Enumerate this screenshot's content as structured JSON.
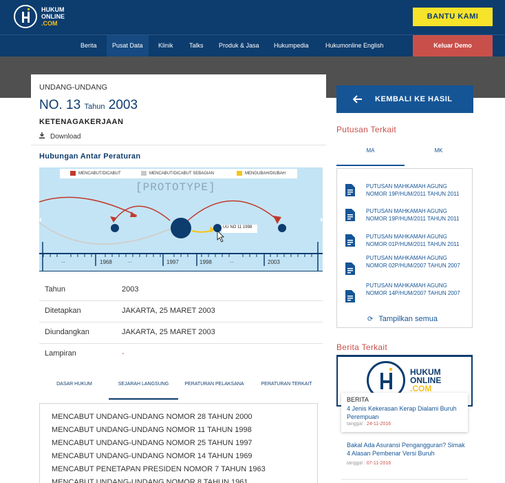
{
  "header": {
    "logo_line1": "HUKUM",
    "logo_line2": "ONLINE",
    "logo_line3": ".COM",
    "donate_button": "BANTU KAMI",
    "nav": [
      "Berita",
      "Pusat Data",
      "Klinik",
      "Talks",
      "Produk & Jasa",
      "Hukumpedia",
      "Hukumonline English"
    ],
    "nav_active": "Pusat Data",
    "logout_button": "Keluar Demo"
  },
  "document": {
    "type": "UNDANG-UNDANG",
    "no_prefix": "NO. 13",
    "tahun_label": "Tahun",
    "year": "2003",
    "title": "KETENAGAKERJAAN",
    "download_label": "Download"
  },
  "relations": {
    "heading": "Hubungan Antar Peraturan",
    "legend": [
      {
        "label": "MENCABUT/DICABUT",
        "color": "#c0392b"
      },
      {
        "label": "MENCABUT/DICABUT SEBAGIAN",
        "color": "#c8c8c8"
      },
      {
        "label": "MENGUBAH/DIUBAH",
        "color": "#f5c518"
      }
    ],
    "watermark": "[PROTOTYPE]",
    "tooltip": "UU NO 11 1998",
    "timeline_labels": [
      "...",
      "1968",
      "...",
      "1997",
      "1998",
      "...",
      "2003"
    ]
  },
  "info": [
    {
      "key": "Tahun",
      "value": "2003"
    },
    {
      "key": "Ditetapkan",
      "value": "JAKARTA, 25 MARET 2003"
    },
    {
      "key": "Diundangkan",
      "value": "JAKARTA, 25 MARET 2003"
    },
    {
      "key": "Lampiran",
      "value": "-"
    }
  ],
  "tabs": [
    "DASAR HUKUM",
    "SEJARAH LANGSUNG",
    "PERATURAN PELAKSANA",
    "PERATURAN TERKAIT"
  ],
  "tab_active": "SEJARAH LANGSUNG",
  "history": [
    "MENCABUT UNDANG-UNDANG NOMOR 28 TAHUN 2000",
    "MENCABUT UNDANG-UNDANG NOMOR 11 TAHUN 1998",
    "MENCABUT UNDANG-UNDANG NOMOR 25 TAHUN 1997",
    "MENCABUT UNDANG-UNDANG NOMOR 14 TAHUN 1969",
    "MENCABUT PENETAPAN PRESIDEN NOMOR 7 TAHUN 1963",
    "MENCABUT UNDANG-UNDANG NOMOR 8 TAHUN 1961"
  ],
  "sidebar": {
    "back_button": "KEMBALI KE HASIL",
    "putusan_heading": "Putusan Terkait",
    "putusan_tabs": [
      "MA",
      "MK"
    ],
    "putusan_active": "MA",
    "putusan_items": [
      "PUTUSAN MAHKAMAH AGUNG NOMOR 19P/HUM/2011 TAHUN 2011",
      "PUTUSAN MAHKAMAH AGUNG NOMOR 19P/HUM/2011 TAHUN 2011",
      "PUTUSAN MAHKAMAH AGUNG NOMOR 01P/HUM/2011 TAHUN 2011",
      "PUTUSAN MAHKAMAH AGUNG NOMOR 02P/HUM/2007 TAHUN 2007",
      "PUTUSAN MAHKAMAH AGUNG NOMOR 14P/HUM/2007 TAHUN 2007"
    ],
    "show_all": "Tampilkan semua",
    "berita_heading": "Berita Terkait",
    "news_logo_line1": "HUKUM",
    "news_logo_line2": "ONLINE",
    "news_logo_line3": ".COM",
    "news": [
      {
        "category": "BERITA",
        "title": "4 Jenis Kekerasan Kerap Dialami Buruh Perempuan",
        "date_label": "tanggal :",
        "date": "24-11-2016"
      },
      {
        "title": "Bakal Ada Asuransi Pengangguran? Simak 4 Alasan Pembenar Versi Buruh",
        "date_label": "tanggal :",
        "date": "07-11-2016"
      }
    ]
  }
}
